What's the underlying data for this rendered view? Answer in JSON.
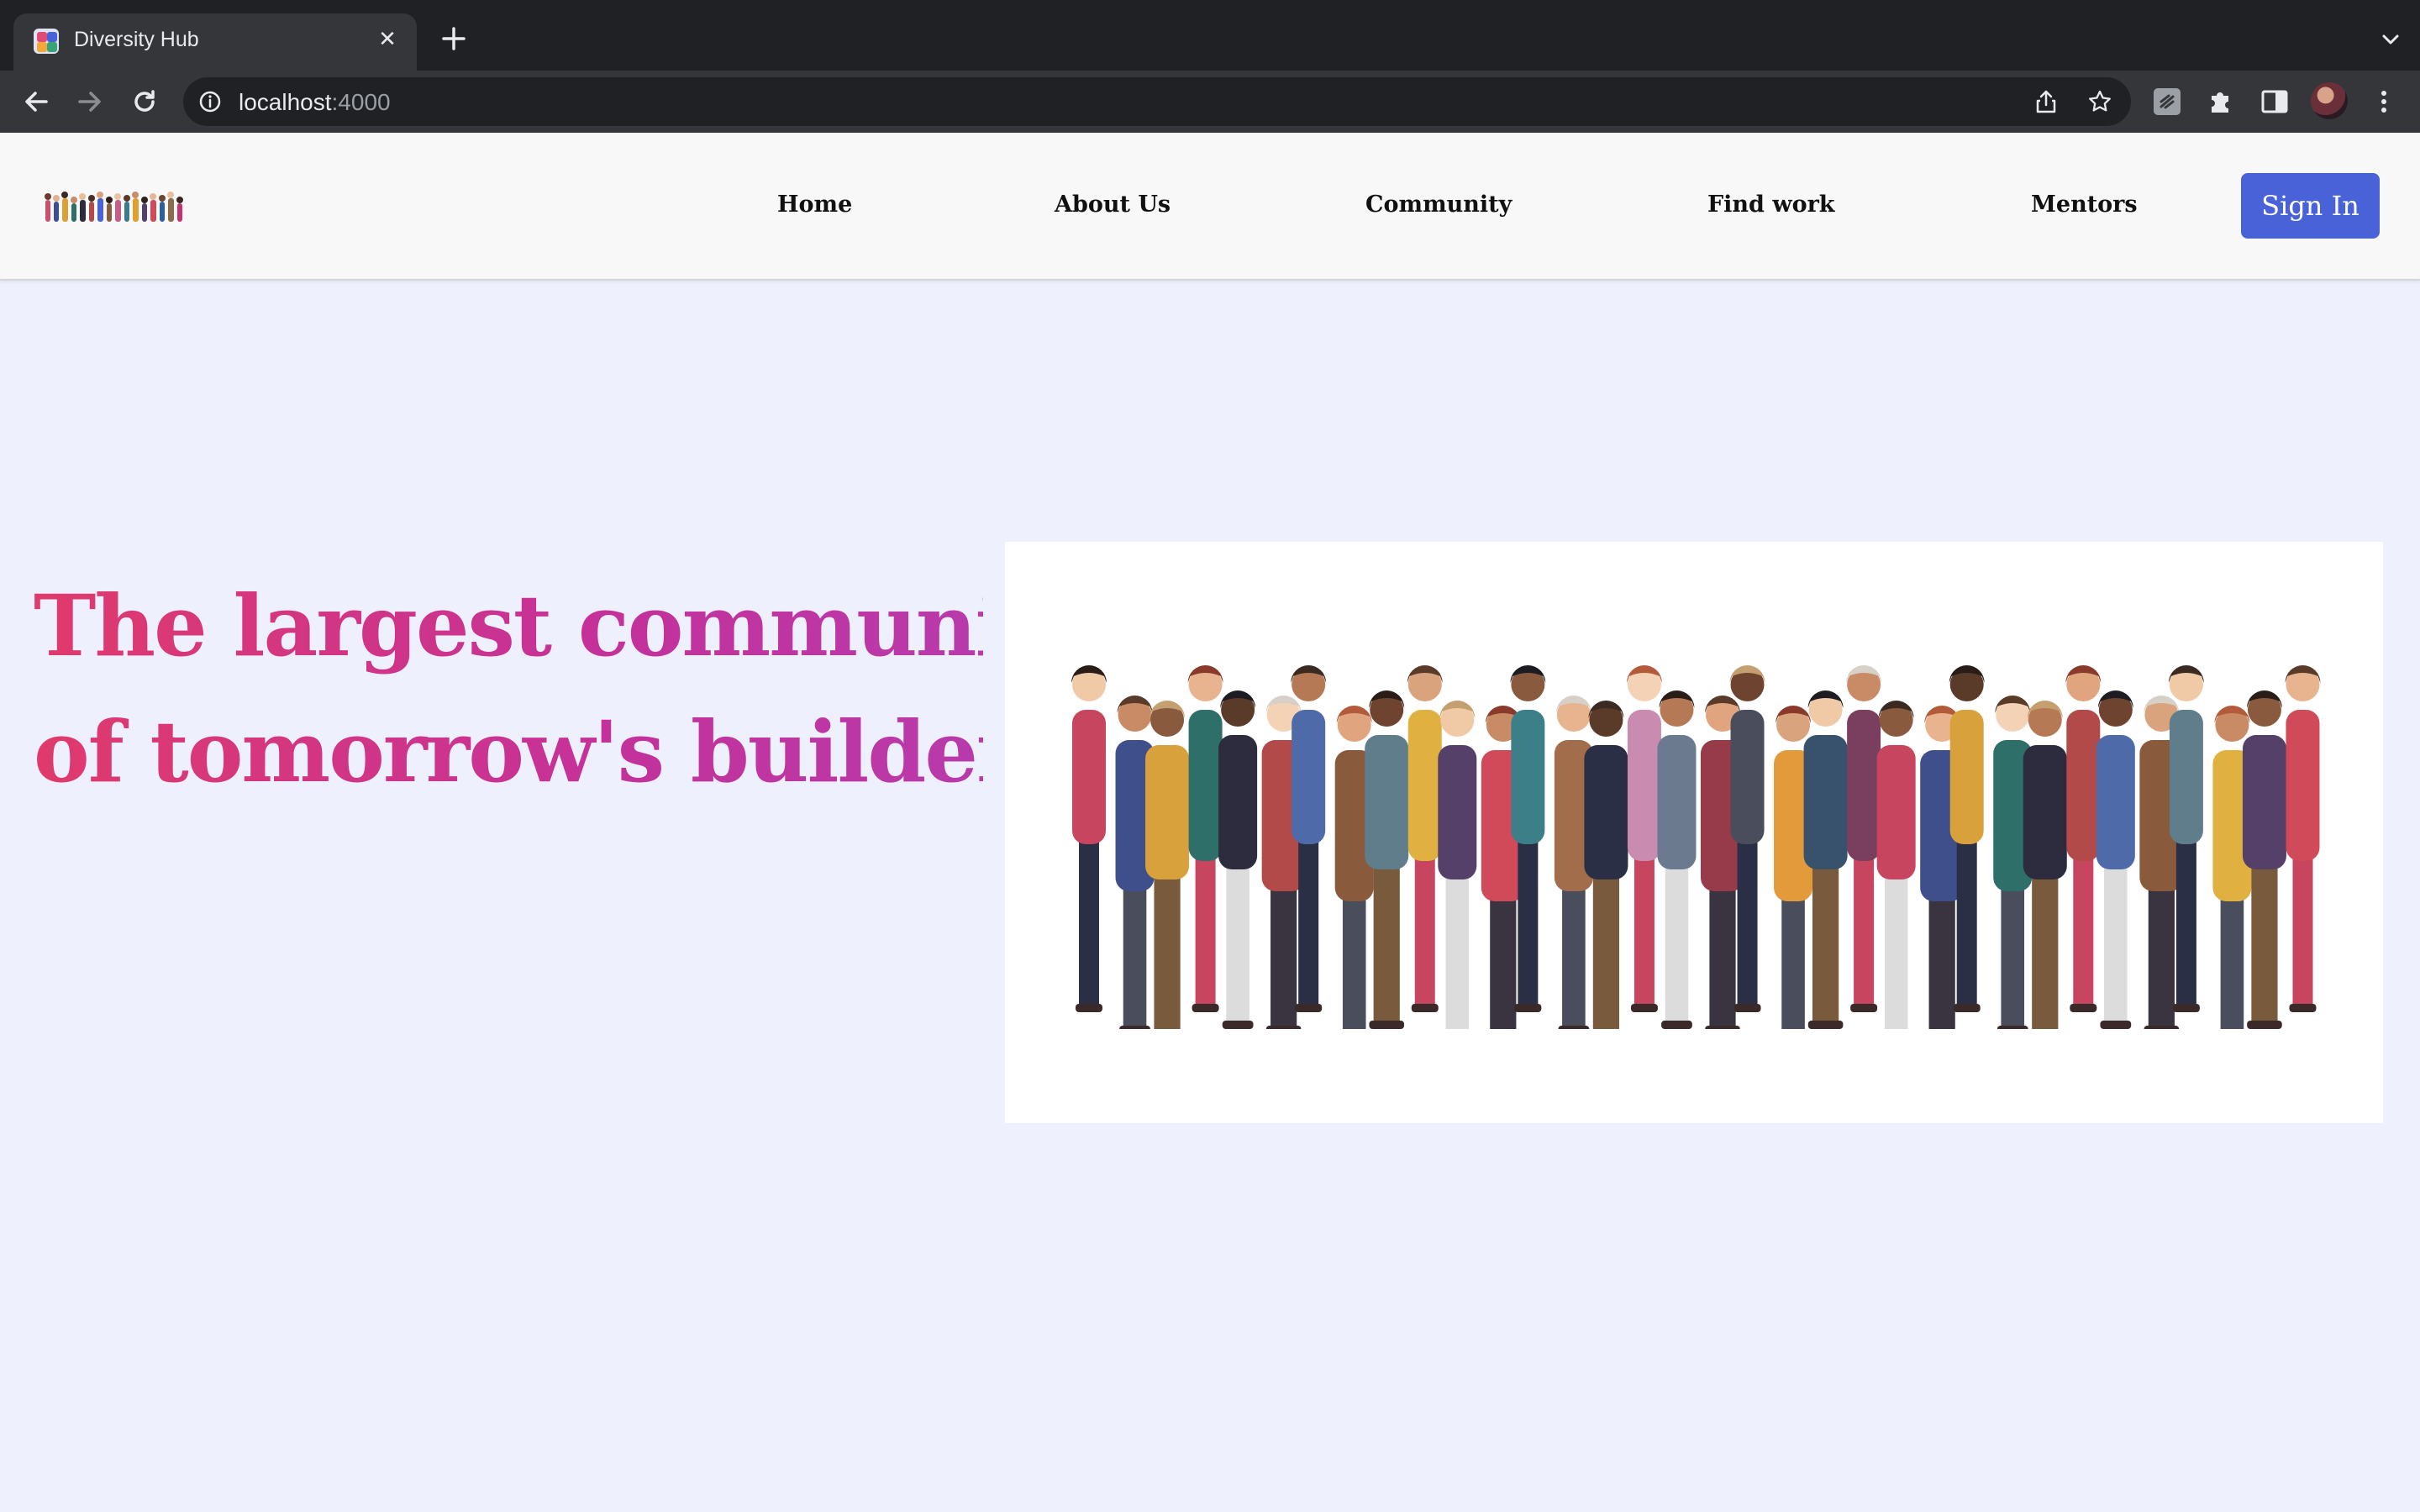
{
  "browser": {
    "tab_title": "Diversity Hub",
    "close_symbol": "✕",
    "url_host": "localhost",
    "url_port": ":4000",
    "icons": [
      "favicon-icon",
      "close-icon",
      "plus-icon",
      "chevron-down-icon",
      "back-icon",
      "forward-icon",
      "reload-icon",
      "info-icon",
      "share-icon",
      "star-icon",
      "extension-icon",
      "puzzle-icon",
      "sidebar-icon",
      "avatar",
      "more-vert-icon"
    ]
  },
  "site": {
    "nav": {
      "links": [
        "Home",
        "About Us",
        "Community",
        "Find work",
        "Mentors"
      ],
      "signin_label": "Sign In",
      "signin_color": "#4a62d8"
    },
    "hero": {
      "title_line1": "The largest community",
      "title_line2": "of tomorrow's builders.",
      "title_gradient": [
        "#e03a6c",
        "#b83aab"
      ],
      "illustration": "crowd-illustration"
    },
    "background_color": "#eff0fd"
  }
}
